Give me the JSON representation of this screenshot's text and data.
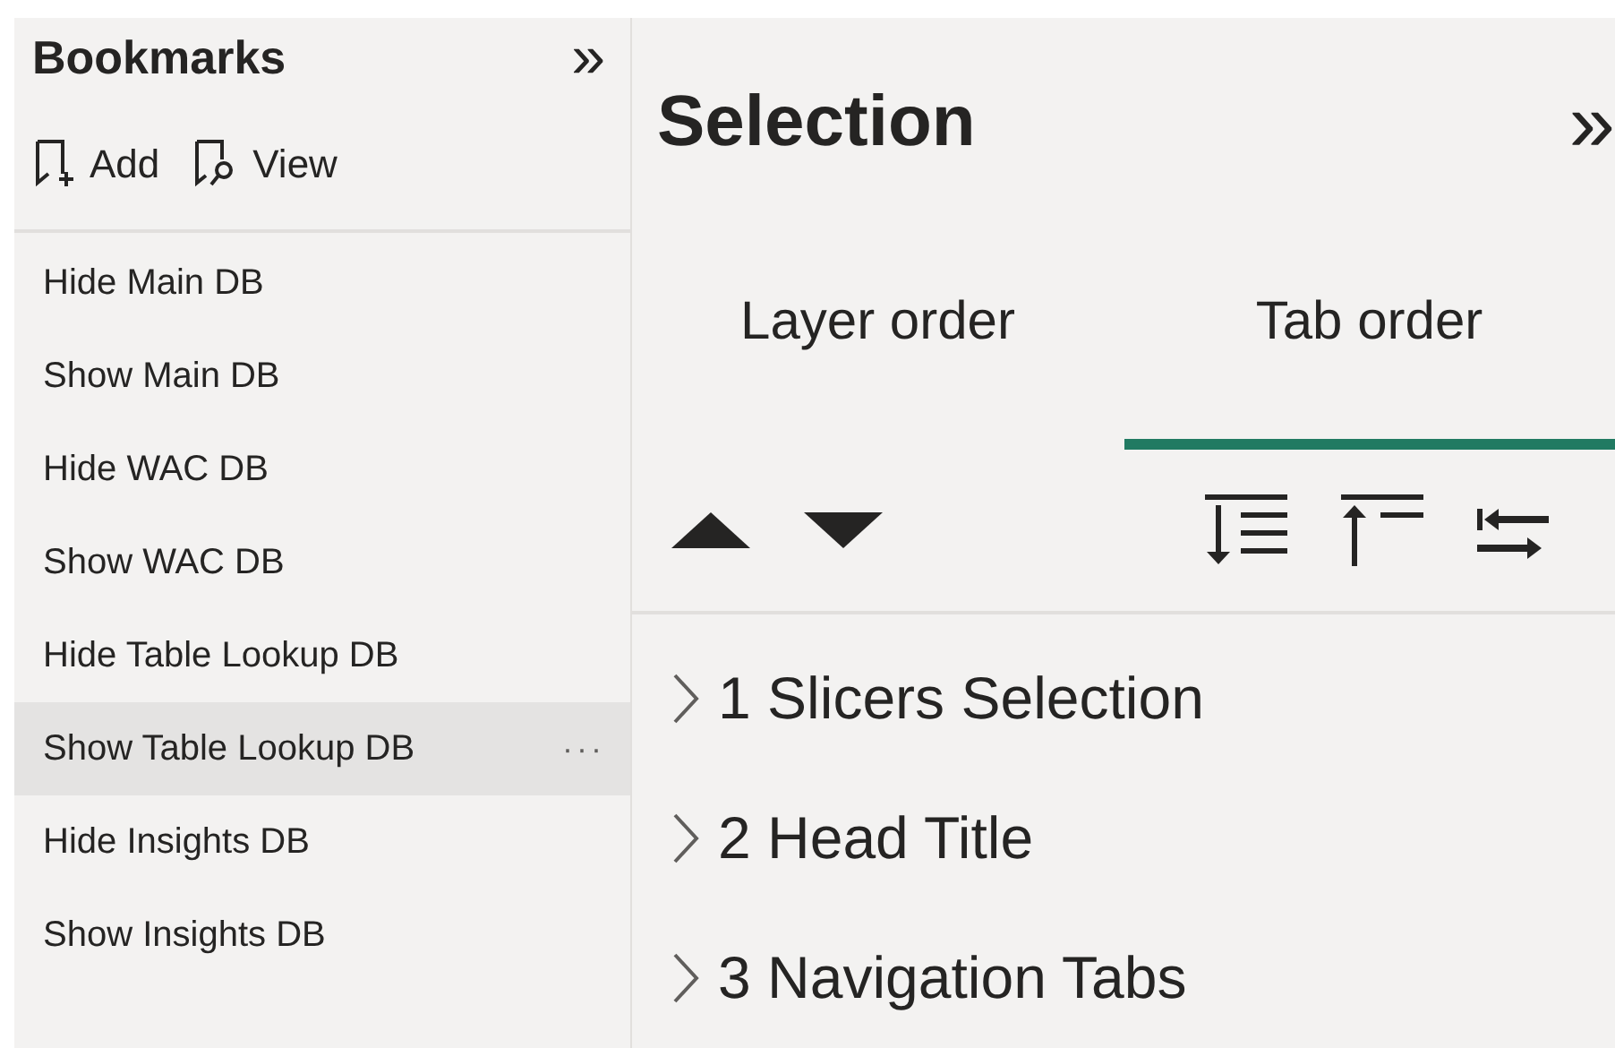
{
  "bookmarks": {
    "title": "Bookmarks",
    "collapse": "»",
    "actions": [
      {
        "kind": "add",
        "label": "Add"
      },
      {
        "kind": "view",
        "label": "View"
      }
    ],
    "items": [
      {
        "label": "Hide Main DB",
        "hovered": false
      },
      {
        "label": "Show Main DB",
        "hovered": false
      },
      {
        "label": "Hide WAC DB",
        "hovered": false
      },
      {
        "label": "Show WAC DB",
        "hovered": false
      },
      {
        "label": "Hide Table Lookup DB",
        "hovered": false
      },
      {
        "label": "Show Table Lookup DB",
        "hovered": true,
        "more": "···"
      },
      {
        "label": "Hide Insights DB",
        "hovered": false
      },
      {
        "label": "Show Insights DB",
        "hovered": false
      }
    ]
  },
  "selection": {
    "title": "Selection",
    "collapse": "»",
    "tabs": [
      {
        "label": "Layer order",
        "selected": false
      },
      {
        "label": "Tab order",
        "selected": true
      }
    ],
    "items": [
      {
        "label": "1 Slicers Selection"
      },
      {
        "label": "2 Head Title"
      },
      {
        "label": "3 Navigation Tabs"
      }
    ]
  }
}
